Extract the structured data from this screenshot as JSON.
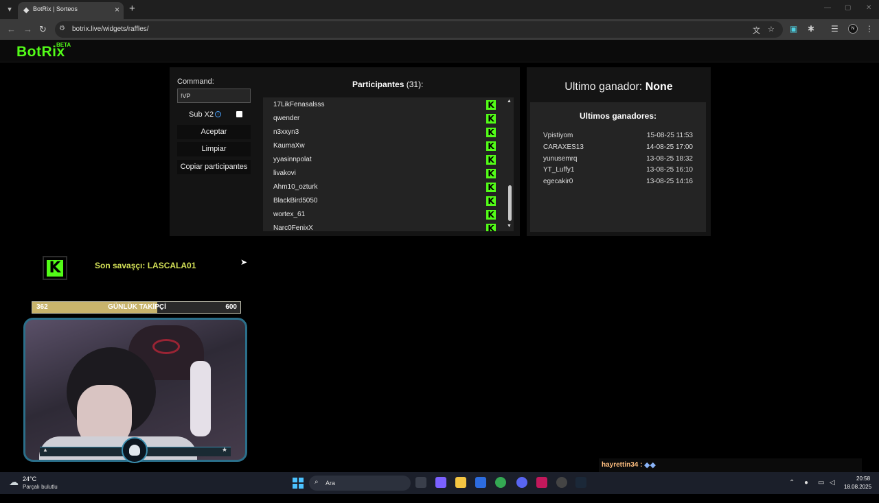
{
  "browser": {
    "tab_title": "BotRix | Sorteos",
    "url": "botrix.live/widgets/raffles/",
    "profile_initials": "N"
  },
  "site": {
    "logo": "BotRix",
    "logo_badge": "BETA"
  },
  "raffle": {
    "command_label": "Command:",
    "command_value": "!VP",
    "sub_label": "Sub X2",
    "buttons": {
      "accept": "Aceptar",
      "clear": "Limpiar",
      "copy": "Copiar participantes"
    },
    "participants_title": "Participantes",
    "participants_count": "(31):",
    "participants": [
      "17LikFenasalsss",
      "qwender",
      "n3xxyn3",
      "KaumaXw",
      "yyasinnpolat",
      "livakovi",
      "Ahm10_ozturk",
      "BlackBird5050",
      "wortex_61",
      "Narc0FenixX"
    ]
  },
  "winners": {
    "last_winner_label": "Ultimo ganador:",
    "last_winner_value": "None",
    "list_title": "Ultimos ganadores:",
    "list": [
      {
        "name": "Vpistiyom",
        "date": "15-08-25 11:53"
      },
      {
        "name": "CARAXES13",
        "date": "14-08-25 17:00"
      },
      {
        "name": "yunusemrq",
        "date": "13-08-25 18:32"
      },
      {
        "name": "YT_Luffy1",
        "date": "13-08-25 16:10"
      },
      {
        "name": "egecakir0",
        "date": "13-08-25 14:16"
      }
    ]
  },
  "stream": {
    "last_sub": "Son savaşçı: LASCALA01",
    "goal": {
      "current": "362",
      "label": "GÜNLÜK TAKİPÇİ",
      "target": "600",
      "progress": 0.6
    },
    "chat": {
      "user": "hayrettin34 :",
      "emote": "emote-icon"
    }
  },
  "taskbar": {
    "temp": "24°C",
    "weather": "Parçalı bulutlu",
    "search_placeholder": "Ara",
    "time": "20:58",
    "date": "18.08.2025"
  },
  "colors": {
    "kick_green": "#53fc18",
    "panel": "#141414",
    "list_bg": "#232323"
  }
}
